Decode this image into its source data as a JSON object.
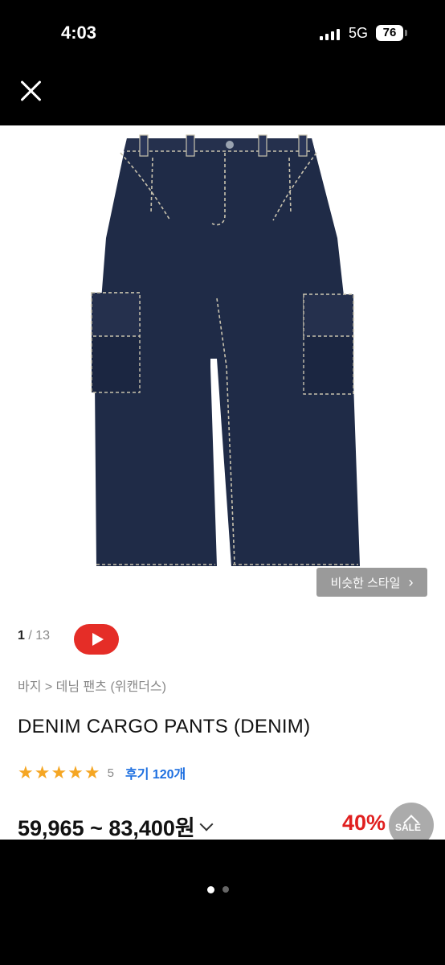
{
  "status": {
    "time": "4:03",
    "network": "5G",
    "battery": "76"
  },
  "product": {
    "similar_style_label": "비슷한 스타일",
    "pager_current": "1",
    "pager_total": "/ 13",
    "breadcrumb": "바지 > 데님 팬츠 (위캔더스)",
    "name": "DENIM CARGO PANTS (DENIM)",
    "stars": "★★★★★",
    "rating": "5",
    "reviews": "후기 120개",
    "price": "59,965 ~ 83,400원",
    "discount": "40%",
    "sale_label": "SALE"
  },
  "colors": {
    "denim": "#1f2b47",
    "accent_red": "#e02020",
    "review_blue": "#1d6fe0",
    "star": "#f5a623"
  },
  "icons": [
    "close-icon",
    "chevron-right-icon",
    "youtube-play-icon",
    "chevron-down-icon",
    "scroll-top-icon"
  ]
}
